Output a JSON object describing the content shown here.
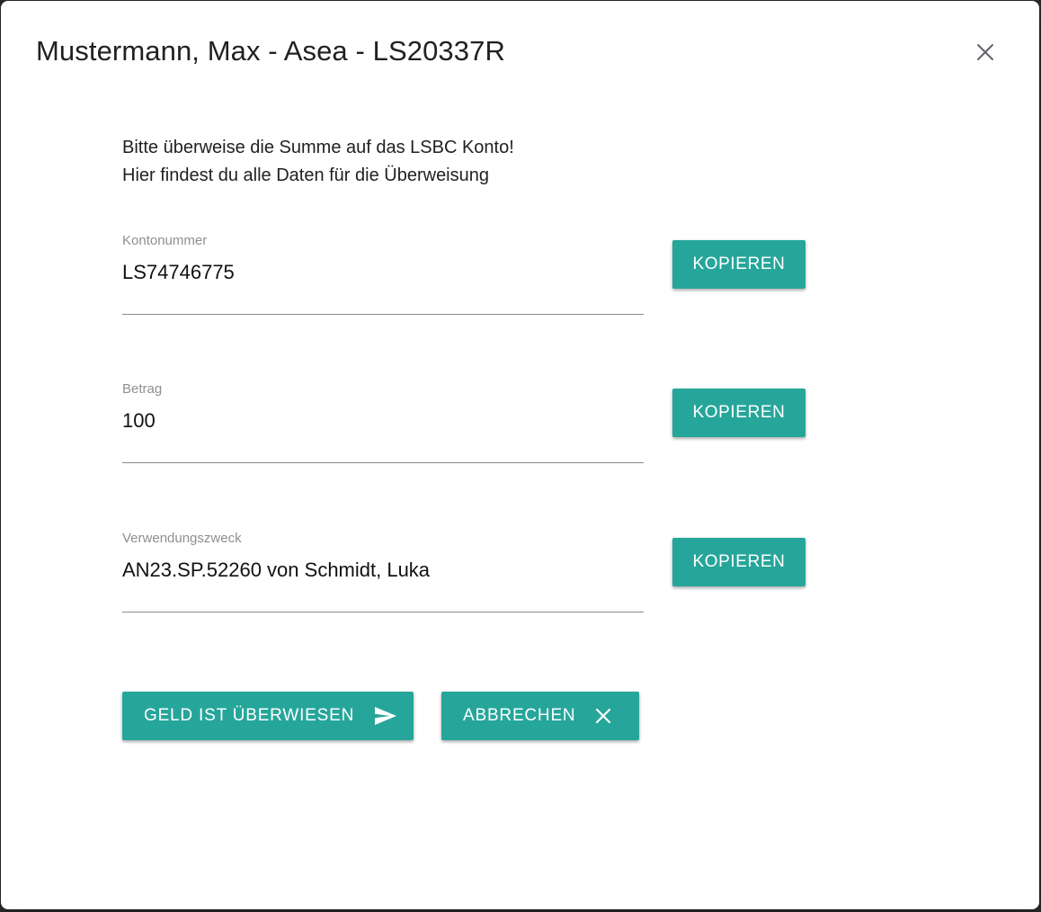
{
  "dialog": {
    "title": "Mustermann, Max - Asea - LS20337R",
    "close_icon": "close-icon"
  },
  "intro": {
    "line1": "Bitte überweise die Summe auf das LSBC Konto!",
    "line2": "Hier findest du alle Daten für die Überweisung"
  },
  "fields": [
    {
      "label": "Kontonummer",
      "value": "LS74746775",
      "button": "KOPIEREN"
    },
    {
      "label": "Betrag",
      "value": "100",
      "button": "KOPIEREN"
    },
    {
      "label": "Verwendungszweck",
      "value": "AN23.SP.52260 von Schmidt, Luka",
      "button": "KOPIEREN"
    }
  ],
  "actions": {
    "confirm": {
      "label": "GELD IST ÜBERWIESEN",
      "icon": "send-icon"
    },
    "cancel": {
      "label": "ABBRECHEN",
      "icon": "close-icon"
    }
  },
  "colors": {
    "accent": "#26a69a",
    "text": "#212121",
    "label": "#8f8f8f"
  }
}
